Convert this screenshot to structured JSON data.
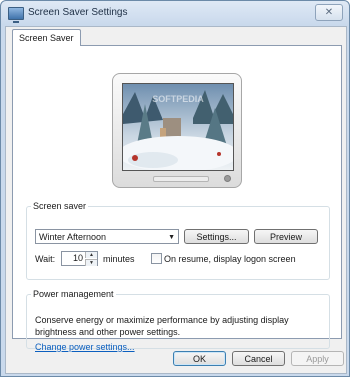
{
  "window": {
    "title": "Screen Saver Settings",
    "close_label": "✕"
  },
  "tabs": [
    {
      "label": "Screen Saver"
    }
  ],
  "preview": {
    "watermark": "SOFTPEDIA"
  },
  "screen_saver": {
    "group_label": "Screen saver",
    "selected": "Winter Afternoon",
    "settings_label": "Settings...",
    "preview_label": "Preview",
    "wait_label": "Wait:",
    "wait_value": "10",
    "minutes_label": "minutes",
    "resume_label": "On resume, display logon screen",
    "resume_checked": false
  },
  "power": {
    "group_label": "Power management",
    "description": "Conserve energy or maximize performance by adjusting display brightness and other power settings.",
    "link_label": "Change power settings..."
  },
  "footer": {
    "ok_label": "OK",
    "cancel_label": "Cancel",
    "apply_label": "Apply"
  }
}
